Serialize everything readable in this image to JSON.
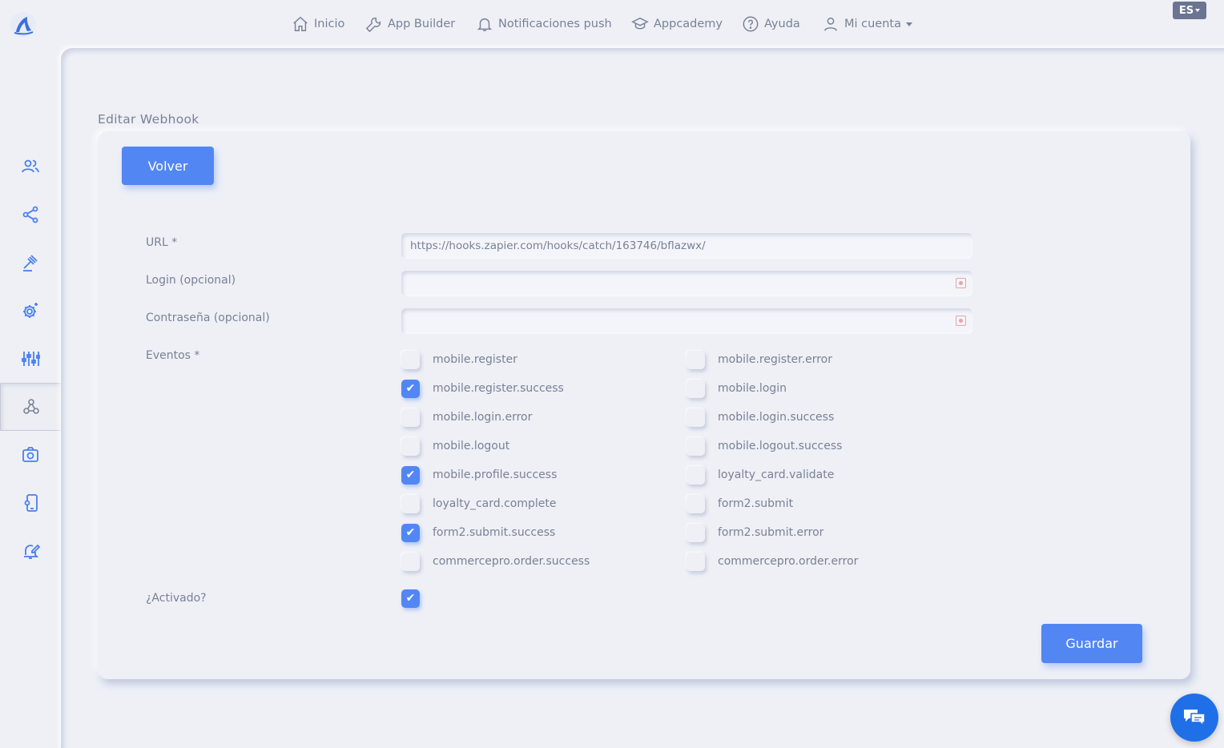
{
  "nav": {
    "items": [
      {
        "label": "Inicio",
        "icon": "home-icon"
      },
      {
        "label": "App Builder",
        "icon": "wrench-icon"
      },
      {
        "label": "Notificaciones push",
        "icon": "bell-icon"
      },
      {
        "label": "Appcademy",
        "icon": "graduation-cap-icon"
      },
      {
        "label": "Ayuda",
        "icon": "help-circle-icon"
      },
      {
        "label": "Mi cuenta",
        "icon": "user-icon"
      }
    ],
    "language": "ES"
  },
  "sidebar": {
    "items": [
      {
        "icon": "users-icon"
      },
      {
        "icon": "share-icon"
      },
      {
        "icon": "gavel-icon"
      },
      {
        "icon": "settings-gear-icon"
      },
      {
        "icon": "sliders-icon"
      },
      {
        "icon": "webhook-icon",
        "active": true
      },
      {
        "icon": "camera-icon"
      },
      {
        "icon": "mobile-settings-icon"
      },
      {
        "icon": "bell-edit-icon"
      }
    ]
  },
  "page": {
    "title": "Editar Webhook",
    "back_label": "Volver",
    "save_label": "Guardar"
  },
  "form": {
    "url_label": "URL *",
    "url_value": "https://hooks.zapier.com/hooks/catch/163746/bflazwx/",
    "login_label": "Login (opcional)",
    "login_value": "",
    "password_label": "Contraseña (opcional)",
    "password_value": "",
    "events_label": "Eventos *",
    "active_label": "¿Activado?",
    "active": true,
    "events_left": [
      {
        "name": "mobile.register",
        "checked": false
      },
      {
        "name": "mobile.register.success",
        "checked": true
      },
      {
        "name": "mobile.login.error",
        "checked": false
      },
      {
        "name": "mobile.logout",
        "checked": false
      },
      {
        "name": "mobile.profile.success",
        "checked": true
      },
      {
        "name": "loyalty_card.complete",
        "checked": false
      },
      {
        "name": "form2.submit.success",
        "checked": true
      },
      {
        "name": "commercepro.order.success",
        "checked": false
      }
    ],
    "events_right": [
      {
        "name": "mobile.register.error",
        "checked": false
      },
      {
        "name": "mobile.login",
        "checked": false
      },
      {
        "name": "mobile.login.success",
        "checked": false
      },
      {
        "name": "mobile.logout.success",
        "checked": false
      },
      {
        "name": "loyalty_card.validate",
        "checked": false
      },
      {
        "name": "form2.submit",
        "checked": false
      },
      {
        "name": "form2.submit.error",
        "checked": false
      },
      {
        "name": "commercepro.order.error",
        "checked": false
      }
    ]
  },
  "colors": {
    "accent": "#5286f3",
    "background": "#eef0f6",
    "text": "#7a8196",
    "chat": "#1f6fe8"
  }
}
